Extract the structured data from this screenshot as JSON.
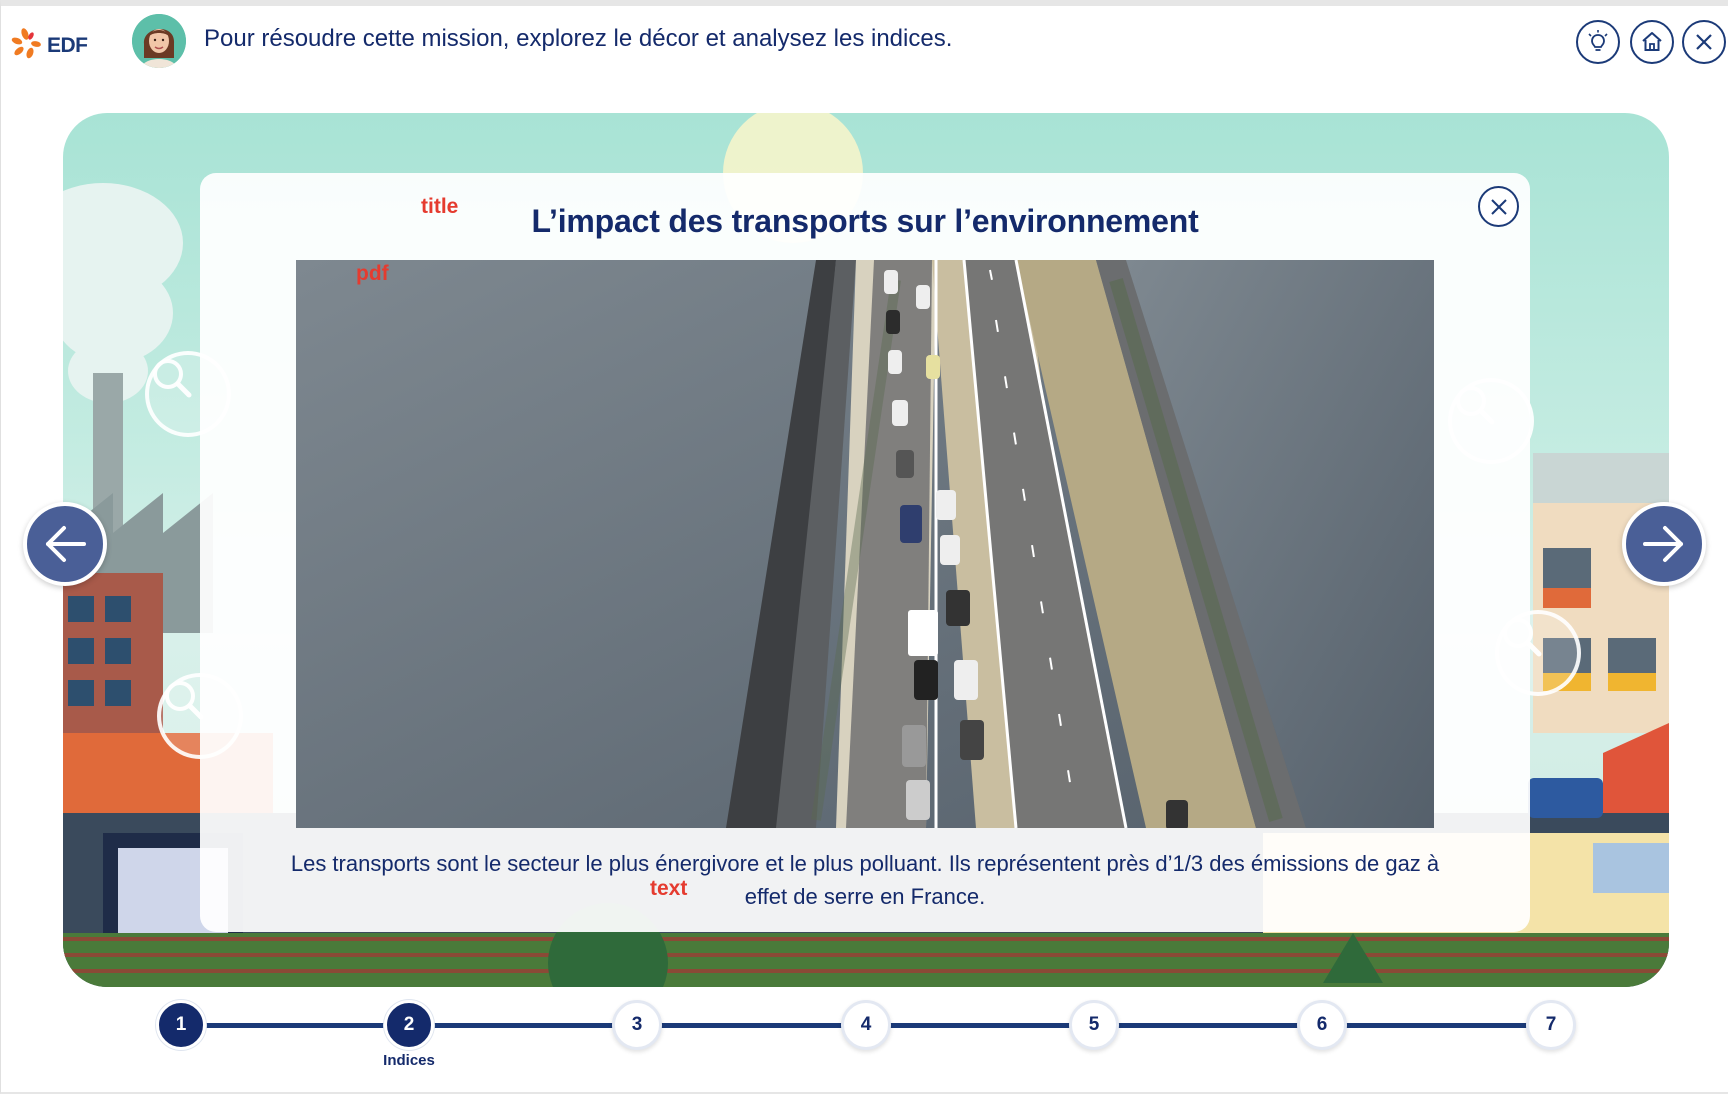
{
  "header": {
    "brand": "EDF",
    "instruction": "Pour résoudre cette mission, explorez le décor et analysez les indices.",
    "buttons": [
      {
        "name": "hint",
        "icon": "lightbulb-icon"
      },
      {
        "name": "home",
        "icon": "home-icon"
      },
      {
        "name": "close",
        "icon": "close-icon"
      }
    ]
  },
  "modal": {
    "title": "L’impact des transports sur l’environnement",
    "title_tag": "title",
    "pdf_tag": "pdf",
    "text_tag": "text",
    "body_line1": "Les transports sont le secteur le plus énergivore et le plus polluant. Ils représentent près d’1/3 des émissions de gaz à",
    "body_line2": "effet de serre en France."
  },
  "stepper": {
    "steps": [
      {
        "number": "1",
        "state": "completed"
      },
      {
        "number": "2",
        "state": "current",
        "label": "Indices"
      },
      {
        "number": "3",
        "state": "upcoming"
      },
      {
        "number": "4",
        "state": "upcoming"
      },
      {
        "number": "5",
        "state": "upcoming"
      },
      {
        "number": "6",
        "state": "upcoming"
      },
      {
        "number": "7",
        "state": "upcoming"
      }
    ]
  },
  "colors": {
    "navy": "#142a6b",
    "accent_red": "#e53b2f",
    "sky": "#a8e3d5",
    "arrow_button": "#4a5f97"
  }
}
